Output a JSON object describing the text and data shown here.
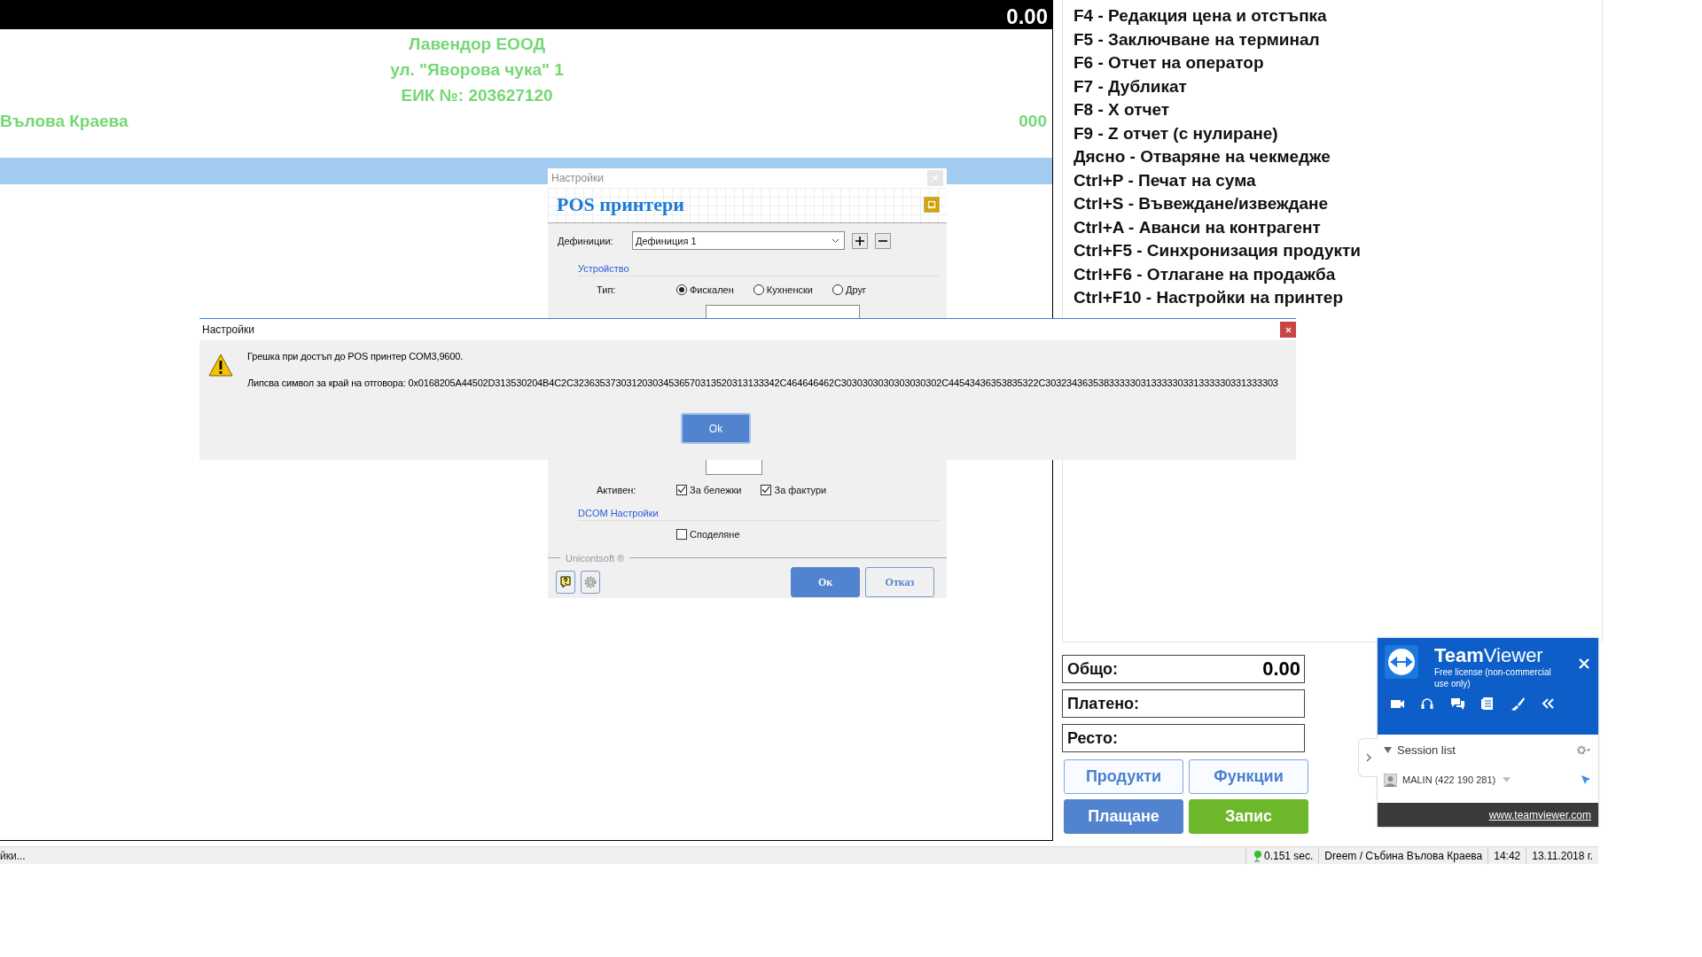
{
  "top_bar": {
    "total": "0.00"
  },
  "receipt": {
    "company": "Лавендор ЕООД",
    "address": "ул. \"Яворова чука\" 1",
    "eik": "ЕИК №: 203627120",
    "operator": "Вълова Краева",
    "number": "000"
  },
  "shortcuts": [
    "F4 - Редакция цена и отстъпка",
    "F5 - Заключване на терминал",
    "F6 - Отчет на оператор",
    "F7 - Дубликат",
    "F8 - X отчет",
    "F9 - Z отчет (с нулиране)",
    "Дясно - Отваряне на чекмедже",
    "Ctrl+P - Печат на сума",
    "Ctrl+S - Въвеждане/извеждане",
    "Ctrl+A - Аванси на контрагент",
    "Ctrl+F5 - Синхронизация продукти",
    "Ctrl+F6 - Отлагане на продажба",
    "Ctrl+F10 - Настройки на принтер"
  ],
  "totals": [
    {
      "label": "Общо:",
      "value": "0.00"
    },
    {
      "label": "Платено:"
    },
    {
      "label": "Ресто:"
    }
  ],
  "action_buttons": [
    {
      "label": "Продукти",
      "kind": "outline"
    },
    {
      "label": "Функции",
      "kind": "outline"
    },
    {
      "label": "Плащане",
      "kind": "primary"
    },
    {
      "label": "Запис",
      "kind": "success"
    }
  ],
  "settings_dialog": {
    "title": "Настройки",
    "heading": "POS принтери",
    "definitions_label": "Дефиниции:",
    "definition": "Дефиниция 1",
    "device_section": "Устройство",
    "type_label": "Тип:",
    "types": [
      {
        "label": "Фискален",
        "selected": true
      },
      {
        "label": "Кухненски",
        "selected": false
      },
      {
        "label": "Друг",
        "selected": false
      }
    ],
    "active_label": "Активен:",
    "active_options": [
      {
        "label": "За бележки",
        "checked": true
      },
      {
        "label": "За фактури",
        "checked": true
      }
    ],
    "dcom_section": "DCOM Настройки",
    "sharing": {
      "label": "Споделяне",
      "checked": false
    },
    "brand": "Unicontsoft ®",
    "buttons": [
      {
        "label": "Ок",
        "kind": "primary"
      },
      {
        "label": "Отказ",
        "kind": "secondary"
      }
    ]
  },
  "error_dialog": {
    "title": "Настройки",
    "message": "Грешка при достъп до POS принтер COM3,9600.",
    "detail": "Липсва символ за край на отговора: 0x0168205A44502D313530204B4C2C323635373031203034536570313520313133342C464646462C3030303030303030302C44543436353835322C30323436353833333031333330331333330331333303",
    "button": "Ok"
  },
  "teamviewer": {
    "title": "**Team**Viewer",
    "license": "Free license (non-commercial use only)",
    "session_list": "Session list",
    "session": "MALIN (422 190 281)",
    "link": "www.teamviewer.com"
  },
  "status_bar": {
    "left": "йки...",
    "ping": "0.151 sec.",
    "user": "Dreem / Събина Вълова Краева",
    "time": "14:42",
    "date": "13.11.2018 г."
  }
}
